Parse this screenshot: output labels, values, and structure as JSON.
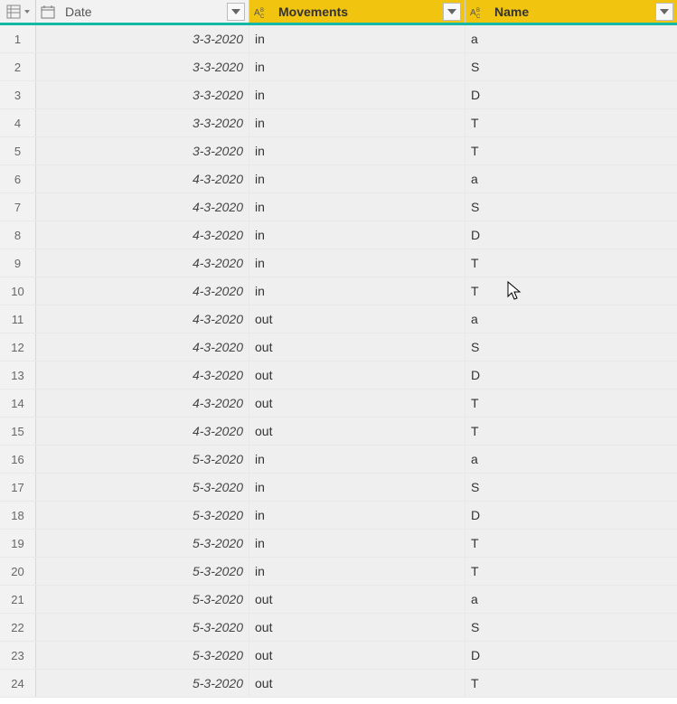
{
  "columns": {
    "date": {
      "label": "Date",
      "type": "date"
    },
    "mov": {
      "label": "Movements",
      "type": "text"
    },
    "name": {
      "label": "Name",
      "type": "text"
    }
  },
  "rows": [
    {
      "n": "1",
      "date": "3-3-2020",
      "mov": "in",
      "name": "a"
    },
    {
      "n": "2",
      "date": "3-3-2020",
      "mov": "in",
      "name": "S"
    },
    {
      "n": "3",
      "date": "3-3-2020",
      "mov": "in",
      "name": "D"
    },
    {
      "n": "4",
      "date": "3-3-2020",
      "mov": "in",
      "name": "T"
    },
    {
      "n": "5",
      "date": "3-3-2020",
      "mov": "in",
      "name": "T"
    },
    {
      "n": "6",
      "date": "4-3-2020",
      "mov": "in",
      "name": "a"
    },
    {
      "n": "7",
      "date": "4-3-2020",
      "mov": "in",
      "name": "S"
    },
    {
      "n": "8",
      "date": "4-3-2020",
      "mov": "in",
      "name": "D"
    },
    {
      "n": "9",
      "date": "4-3-2020",
      "mov": "in",
      "name": "T"
    },
    {
      "n": "10",
      "date": "4-3-2020",
      "mov": "in",
      "name": "T"
    },
    {
      "n": "11",
      "date": "4-3-2020",
      "mov": "out",
      "name": "a"
    },
    {
      "n": "12",
      "date": "4-3-2020",
      "mov": "out",
      "name": "S"
    },
    {
      "n": "13",
      "date": "4-3-2020",
      "mov": "out",
      "name": "D"
    },
    {
      "n": "14",
      "date": "4-3-2020",
      "mov": "out",
      "name": "T"
    },
    {
      "n": "15",
      "date": "4-3-2020",
      "mov": "out",
      "name": "T"
    },
    {
      "n": "16",
      "date": "5-3-2020",
      "mov": "in",
      "name": "a"
    },
    {
      "n": "17",
      "date": "5-3-2020",
      "mov": "in",
      "name": "S"
    },
    {
      "n": "18",
      "date": "5-3-2020",
      "mov": "in",
      "name": "D"
    },
    {
      "n": "19",
      "date": "5-3-2020",
      "mov": "in",
      "name": "T"
    },
    {
      "n": "20",
      "date": "5-3-2020",
      "mov": "in",
      "name": "T"
    },
    {
      "n": "21",
      "date": "5-3-2020",
      "mov": "out",
      "name": "a"
    },
    {
      "n": "22",
      "date": "5-3-2020",
      "mov": "out",
      "name": "S"
    },
    {
      "n": "23",
      "date": "5-3-2020",
      "mov": "out",
      "name": "D"
    },
    {
      "n": "24",
      "date": "5-3-2020",
      "mov": "out",
      "name": "T"
    }
  ]
}
